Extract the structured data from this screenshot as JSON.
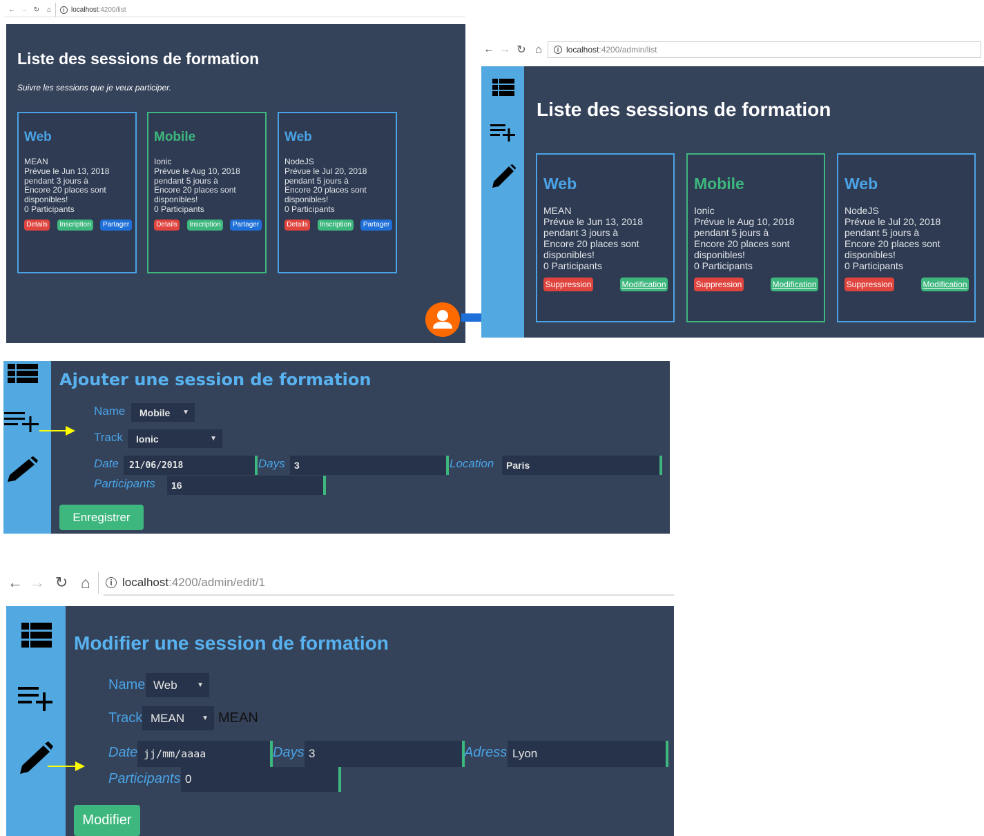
{
  "screens": {
    "list": {
      "url_host": "localhost",
      "url_path": ":4200/list",
      "title": "Liste des sessions de formation",
      "subtitle": "Suivre les sessions que je veux participer.",
      "buttons": [
        "Details",
        "Inscription",
        "Partager"
      ],
      "cards": [
        {
          "name": "Web",
          "lines": [
            "MEAN",
            "Prévue le Jun 13, 2018",
            "pendant 3 jours à",
            "Encore 20 places sont",
            "disponibles!",
            "0 Participants"
          ]
        },
        {
          "name": "Mobile",
          "lines": [
            "Ionic",
            "Prévue le Aug 10, 2018",
            "pendant 5 jours à",
            "Encore 20 places sont",
            "disponibles!",
            "0 Participants"
          ]
        },
        {
          "name": "Web",
          "lines": [
            "NodeJS",
            "Prévue le Jul 20, 2018",
            "pendant 5 jours à",
            "Encore 20 places sont",
            "disponibles!",
            "0 Participants"
          ]
        }
      ]
    },
    "admin_list": {
      "url_host": "localhost",
      "url_path": ":4200/admin/list",
      "title": "Liste des sessions de formation",
      "buttons": [
        "Suppression",
        "Modification"
      ],
      "cards": [
        {
          "name": "Web",
          "lines": [
            "MEAN",
            "Prévue le Jun 13, 2018",
            "pendant 3 jours à",
            "Encore 20 places sont",
            "disponibles!",
            "0 Participants"
          ]
        },
        {
          "name": "Mobile",
          "lines": [
            "Ionic",
            "Prévue le Aug 10, 2018",
            "pendant 5 jours à",
            "Encore 20 places sont",
            "disponibles!",
            "0 Participants"
          ]
        },
        {
          "name": "Web",
          "lines": [
            "NodeJS",
            "Prévue le Jul 20, 2018",
            "pendant 5 jours à",
            "Encore 20 places sont",
            "disponibles!",
            "0 Participants"
          ]
        }
      ]
    },
    "add": {
      "title": "Ajouter une session de formation",
      "name_label": "Name",
      "name_value": "Mobile",
      "track_label": "Track",
      "track_value": "Ionic",
      "date_label": "Date",
      "date_value": "21/06/2018",
      "days_label": "Days",
      "days_value": "3",
      "location_label": "Location",
      "location_value": "Paris",
      "participants_label": "Participants",
      "participants_value": "16",
      "submit_label": "Enregistrer"
    },
    "edit": {
      "url_host": "localhost",
      "url_path": ":4200/admin/edit/1",
      "title": "Modifier une session de formation",
      "name_label": "Name",
      "name_value": "Web",
      "track_label": "Track",
      "track_value": "MEAN",
      "track_echo": "MEAN",
      "date_label": "Date",
      "date_value": "jj/mm/aaaa",
      "days_label": "Days",
      "days_value": "3",
      "adress_label": "Adress",
      "adress_value": "Lyon",
      "participants_label": "Participants",
      "participants_value": "0",
      "submit_label": "Modifier"
    }
  },
  "icons": [
    "list-icon",
    "playlist-add-icon",
    "pencil-icon",
    "user-icon",
    "arrow-right-icon",
    "back-icon",
    "forward-icon",
    "reload-icon",
    "home-icon",
    "info-icon"
  ],
  "colors": {
    "panel": "#34425a",
    "sidebar": "#52a8e0",
    "accent_blue": "#4aa3e6",
    "accent_green": "#3eb77e",
    "danger": "#e0443e",
    "share": "#1f6fd8",
    "pointer": "#ffff00",
    "avatar": "#ff6a00"
  }
}
